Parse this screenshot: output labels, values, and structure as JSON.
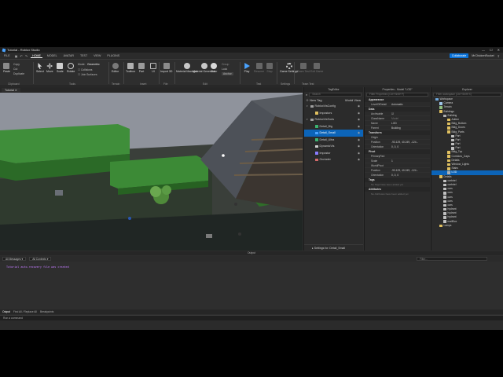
{
  "titlebar": {
    "title": "Tutorial - Roblox Studio"
  },
  "menubar": {
    "file": "FILE",
    "tabs": [
      "HOME",
      "MODEL",
      "AVATAR",
      "TEST",
      "VIEW",
      "PLUGINS"
    ],
    "active_tab": "HOME",
    "collaborate": "Collaborate",
    "user": "MrChickenRocket"
  },
  "ribbon": {
    "clipboard": {
      "paste": "Paste",
      "copy": "Copy",
      "cut": "Cut",
      "duplicate": "Duplicate",
      "group": "Clipboard"
    },
    "tools": {
      "select": "Select",
      "move": "Move",
      "scale": "Scale",
      "rotate": "Rotate",
      "mode_label": "Mode:",
      "mode_value": "Geometric",
      "collisions": "Collisions",
      "join_surfaces": "Join Surfaces",
      "group": "Tools"
    },
    "terrain": {
      "editor": "Editor",
      "group": "Terrain"
    },
    "insert": {
      "toolbox": "Toolbox",
      "part": "Part",
      "ui": "UI",
      "group": "Insert"
    },
    "file": {
      "import3d": "Import 3D",
      "group": "File"
    },
    "edit": {
      "material_manager": "Material Manager",
      "material_generator": "Material Generator",
      "color": "Color",
      "group_btn": "Group",
      "lock": "Lock",
      "anchor": "Anchor",
      "group": "Edit"
    },
    "test": {
      "play": "Play",
      "resume": "Resume",
      "stop": "Stop",
      "group": "Test"
    },
    "settings": {
      "game_settings": "Game Settings",
      "group": "Settings"
    },
    "team_test": {
      "team_test": "Team Test",
      "exit_game": "Exit Game",
      "group": "Team Test"
    }
  },
  "viewport": {
    "tab": "Tutorial"
  },
  "tag_editor": {
    "title": "TagEditor",
    "search_placeholder": "Search",
    "new_tag": "New Tag",
    "world_view": "World View",
    "rows": [
      {
        "label": "RobloxVisConfig",
        "indent": 0,
        "color": "#a0a0a0",
        "selected": false,
        "group": true
      },
      {
        "label": "Impostors",
        "indent": 1,
        "color": "#e0c060",
        "selected": false,
        "group": false
      },
      {
        "label": "RobloxVisTools",
        "indent": 0,
        "color": "#a0a0a0",
        "selected": false,
        "group": true
      },
      {
        "label": "Detail_Big",
        "indent": 1,
        "color": "#3cb371",
        "selected": false,
        "group": false
      },
      {
        "label": "Detail_Small",
        "indent": 1,
        "color": "#4aa3ff",
        "selected": true,
        "group": false
      },
      {
        "label": "Detail_Ultra",
        "indent": 1,
        "color": "#3cb371",
        "selected": false,
        "group": false
      },
      {
        "label": "DynamicVis",
        "indent": 1,
        "color": "#d0d0d0",
        "selected": false,
        "group": false
      },
      {
        "label": "Impostor",
        "indent": 1,
        "color": "#8a7cff",
        "selected": false,
        "group": false
      },
      {
        "label": "Occluder",
        "indent": 1,
        "color": "#d46b6b",
        "selected": false,
        "group": false
      }
    ],
    "footer": "Settings for: Detail_Small"
  },
  "properties": {
    "title": "Properties - Model \"LOD\"",
    "filter_placeholder": "Filter Properties (Ctrl+Shift+P)",
    "sections": [
      {
        "name": "Appearance",
        "rows": [
          {
            "k": "LevelOfDetail",
            "v": "Automatic"
          }
        ]
      },
      {
        "name": "Data",
        "rows": [
          {
            "k": "Archivable",
            "v": "☑"
          },
          {
            "k": "ClassName",
            "v": "Model",
            "muted": true
          },
          {
            "k": "Name",
            "v": "LOD"
          },
          {
            "k": "Parent",
            "v": "Building"
          }
        ]
      },
      {
        "name": "Transform",
        "rows": [
          {
            "k": "Origin",
            "v": ""
          },
          {
            "k": "Position",
            "v": "-93.129, 40.249, -124..."
          },
          {
            "k": "Orientation",
            "v": "0, 0, 0"
          }
        ]
      },
      {
        "name": "Pivot",
        "rows": [
          {
            "k": "PrimaryPart",
            "v": ""
          },
          {
            "k": "Scale",
            "v": "1"
          },
          {
            "k": "WorldPivot",
            "v": ""
          },
          {
            "k": "Position",
            "v": "-93.129, 40.249, -124..."
          },
          {
            "k": "Orientation",
            "v": "0, 0, 0"
          }
        ]
      },
      {
        "name": "Tags",
        "note": "No Tags have been added yet"
      },
      {
        "name": "Attributes",
        "note": "No Attributes have been added yet"
      }
    ]
  },
  "explorer": {
    "title": "Explorer",
    "filter_placeholder": "Filter workspace (Ctrl+Shift+X)",
    "rows": [
      {
        "label": "Workspace",
        "indent": 1,
        "color": "#6fa8dc"
      },
      {
        "label": "Camera",
        "indent": 2,
        "color": "#9fc5e8"
      },
      {
        "label": "Terrain",
        "indent": 2,
        "color": "#8fbf7f"
      },
      {
        "label": "Buildings",
        "indent": 2,
        "color": "#e0c060"
      },
      {
        "label": "Building",
        "indent": 3,
        "color": "#b0b0b0"
      },
      {
        "label": "Addon",
        "indent": 4,
        "color": "#e0c060"
      },
      {
        "label": "Bldg_Bottom",
        "indent": 4,
        "color": "#e0c060"
      },
      {
        "label": "Bldg_Doors",
        "indent": 4,
        "color": "#e0c060"
      },
      {
        "label": "Bldg_Parts",
        "indent": 4,
        "color": "#e0c060"
      },
      {
        "label": "Part",
        "indent": 5,
        "color": "#c0c0c0"
      },
      {
        "label": "Part",
        "indent": 5,
        "color": "#c0c0c0"
      },
      {
        "label": "Part",
        "indent": 5,
        "color": "#c0c0c0"
      },
      {
        "label": "Part",
        "indent": 5,
        "color": "#c0c0c0"
      },
      {
        "label": "Bldg_Top",
        "indent": 4,
        "color": "#e0c060"
      },
      {
        "label": "Corridors_Caps",
        "indent": 4,
        "color": "#e0c060"
      },
      {
        "label": "Details",
        "indent": 4,
        "color": "#e0c060"
      },
      {
        "label": "Window_Lights",
        "indent": 4,
        "color": "#e0c060"
      },
      {
        "label": "Stairs",
        "indent": 4,
        "color": "#e0c060"
      },
      {
        "label": "LOD",
        "indent": 4,
        "color": "#b0b0b0",
        "selected": true
      },
      {
        "label": "Details",
        "indent": 2,
        "color": "#e0c060"
      },
      {
        "label": "carbrtel",
        "indent": 3,
        "color": "#c0c0c0"
      },
      {
        "label": "carbrtel",
        "indent": 3,
        "color": "#c0c0c0"
      },
      {
        "label": "cars",
        "indent": 3,
        "color": "#c0c0c0"
      },
      {
        "label": "cars",
        "indent": 3,
        "color": "#c0c0c0"
      },
      {
        "label": "cars",
        "indent": 3,
        "color": "#c0c0c0"
      },
      {
        "label": "cars",
        "indent": 3,
        "color": "#c0c0c0"
      },
      {
        "label": "cars",
        "indent": 3,
        "color": "#c0c0c0"
      },
      {
        "label": "hydrant",
        "indent": 3,
        "color": "#c0c0c0"
      },
      {
        "label": "hydrant",
        "indent": 3,
        "color": "#c0c0c0"
      },
      {
        "label": "hydrant",
        "indent": 3,
        "color": "#c0c0c0"
      },
      {
        "label": "mailBox",
        "indent": 3,
        "color": "#c0c0c0"
      },
      {
        "label": "Lamps",
        "indent": 2,
        "color": "#e0c060"
      }
    ]
  },
  "output": {
    "title": "Output",
    "filter1": "All Messages",
    "filter2": "All Contexts",
    "filter_placeholder": "Filter...",
    "lines": [
      "Tutorial auto-recovery file was created"
    ],
    "bottom_tabs": [
      "Output",
      "Find All / Replace All",
      "Breakpoints"
    ],
    "command_placeholder": "Run a command"
  },
  "colors": {
    "accent": "#0c64b8",
    "collab": "#0a72d8",
    "output_text": "#c47cff"
  }
}
